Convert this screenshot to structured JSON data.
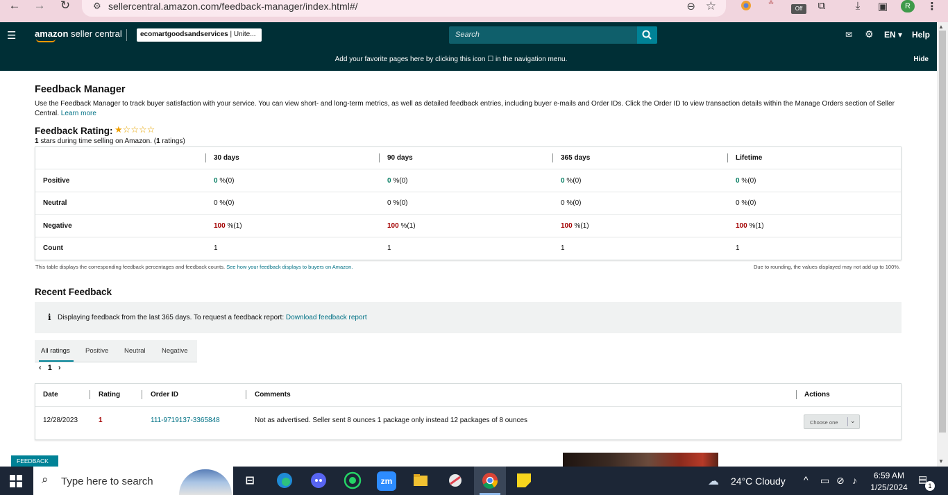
{
  "browser": {
    "url": "sellercentral.amazon.com/feedback-manager/index.html#/",
    "profile_initial": "R",
    "ext_badge": "Off"
  },
  "header": {
    "logo_brand": "amazon",
    "logo_product": "seller central",
    "account": "ecomartgoodsandservices",
    "account_region": "| Unite...",
    "search_placeholder": "Search",
    "language": "EN",
    "help": "Help"
  },
  "favorites_banner": {
    "message": "Add your favorite pages here by clicking this icon ☐ in the navigation menu.",
    "hide": "Hide"
  },
  "page": {
    "title": "Feedback Manager",
    "intro": "Use the Feedback Manager to track buyer satisfaction with your service. You can view short- and long-term metrics, as well as detailed feedback entries, including buyer e-mails and Order IDs. Click the Order ID to view transaction details within the Manage Orders section of Seller Central.",
    "learn_more": "Learn more"
  },
  "rating": {
    "title": "Feedback Rating:",
    "stars": 1,
    "max_stars": 5,
    "stars_value": "1",
    "stars_text": " stars during time selling on Amazon. (",
    "ratings_count": "1",
    "ratings_suffix": " ratings)"
  },
  "metrics": {
    "columns": [
      "30 days",
      "90 days",
      "365 days",
      "Lifetime"
    ],
    "rows": [
      {
        "label": "Positive",
        "values": [
          "0",
          "0",
          "0",
          "0"
        ],
        "suffixes": [
          "%(0)",
          "%(0)",
          "%(0)",
          "%(0)"
        ]
      },
      {
        "label": "Neutral",
        "values": [
          "0",
          "0",
          "0",
          "0"
        ],
        "suffixes": [
          "%(0)",
          "%(0)",
          "%(0)",
          "%(0)"
        ]
      },
      {
        "label": "Negative",
        "values": [
          "100",
          "100",
          "100",
          "100"
        ],
        "suffixes": [
          "%(1)",
          "%(1)",
          "%(1)",
          "%(1)"
        ]
      },
      {
        "label": "Count",
        "values": [
          "1",
          "1",
          "1",
          "1"
        ]
      }
    ],
    "note_left": "This table displays the corresponding feedback percentages and feedback counts.",
    "note_left_link": "See how your feedback displays to buyers on Amazon.",
    "note_right": "Due to rounding, the values displayed may not add up to 100%."
  },
  "recent": {
    "title": "Recent Feedback",
    "info_icon": "i",
    "info_text": "Displaying feedback from the last 365 days. To request a feedback report:",
    "info_link": "Download feedback report",
    "tabs": [
      "All ratings",
      "Positive",
      "Neutral",
      "Negative"
    ],
    "active_tab": "All ratings",
    "page": "1",
    "columns": {
      "date": "Date",
      "rating": "Rating",
      "order_id": "Order ID",
      "comments": "Comments",
      "actions": "Actions"
    },
    "rows": [
      {
        "date": "12/28/2023",
        "rating": "1",
        "order_id": "111-9719137-3365848",
        "comment": "Not as advertised. Seller sent 8 ounces 1 package only instead 12 packages of 8 ounces",
        "action": "Choose one"
      }
    ]
  },
  "feedback_tab": "FEEDBACK ×",
  "taskbar": {
    "search_placeholder": "Type here to search",
    "zoom_label": "zm",
    "weather": "24°C  Cloudy",
    "time": "6:59 AM",
    "date": "1/25/2024",
    "notifications": "1"
  },
  "colors": {
    "header_bg": "#002f36",
    "accent": "#008296",
    "positive": "#067d62",
    "negative": "#a30000",
    "browser_bar": "#f1d5de"
  }
}
